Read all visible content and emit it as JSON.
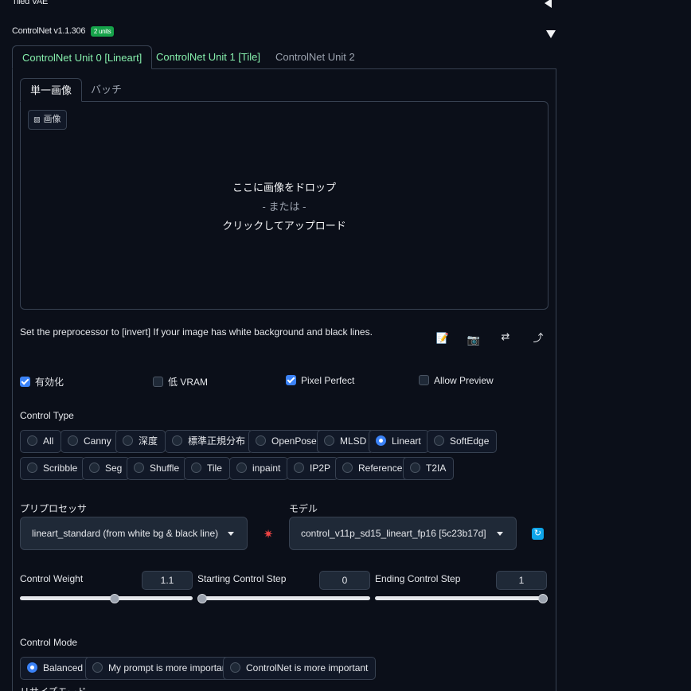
{
  "tiled_vae": {
    "label": "Tiled VAE"
  },
  "controlnet": {
    "title": "ControlNet v1.1.306",
    "badge": "2 units"
  },
  "unit_tabs": [
    {
      "label": "ControlNet Unit 0 [Lineart]"
    },
    {
      "label": "ControlNet Unit 1 [Tile]"
    },
    {
      "label": "ControlNet Unit 2"
    }
  ],
  "image_tabs": [
    {
      "label": "単一画像"
    },
    {
      "label": "バッチ"
    }
  ],
  "drop_area": {
    "chip_label": "画像",
    "line1": "ここに画像をドロップ",
    "line2": "- または -",
    "line3": "クリックしてアップロード"
  },
  "hint": "Set the preprocessor to [invert] If your image has white background and black lines.",
  "toolbar_icons": [
    "new-canvas-icon",
    "camera-icon",
    "swap-icon",
    "send-dimensions-icon"
  ],
  "checkboxes": [
    {
      "label": "有効化",
      "checked": true
    },
    {
      "label": "低 VRAM",
      "checked": false
    },
    {
      "label": "Pixel Perfect",
      "checked": true
    },
    {
      "label": "Allow Preview",
      "checked": false
    }
  ],
  "control_type": {
    "label": "Control Type",
    "options": [
      "All",
      "Canny",
      "深度",
      "標準正規分布",
      "OpenPose",
      "MLSD",
      "Lineart",
      "SoftEdge",
      "Scribble",
      "Seg",
      "Shuffle",
      "Tile",
      "inpaint",
      "IP2P",
      "Reference",
      "T2IA"
    ],
    "selected": "Lineart"
  },
  "preprocessor": {
    "label": "プリプロセッサ",
    "value": "lineart_standard (from white bg & black line)"
  },
  "model": {
    "label": "モデル",
    "value": "control_v11p_sd15_lineart_fp16 [5c23b17d]"
  },
  "sliders": [
    {
      "label": "Control Weight",
      "value": "1.1",
      "fraction": 0.55
    },
    {
      "label": "Starting Control Step",
      "value": "0",
      "fraction": 0.0
    },
    {
      "label": "Ending Control Step",
      "value": "1",
      "fraction": 1.0
    }
  ],
  "control_mode": {
    "label": "Control Mode",
    "options": [
      "Balanced",
      "My prompt is more important",
      "ControlNet is more important"
    ],
    "selected": "Balanced"
  },
  "resize_mode": {
    "label": "リサイズモード"
  },
  "colors": {
    "accent": "#3b82f6",
    "green": "#86efac",
    "badge": "#16a34a",
    "bg": "#0b0f19"
  }
}
